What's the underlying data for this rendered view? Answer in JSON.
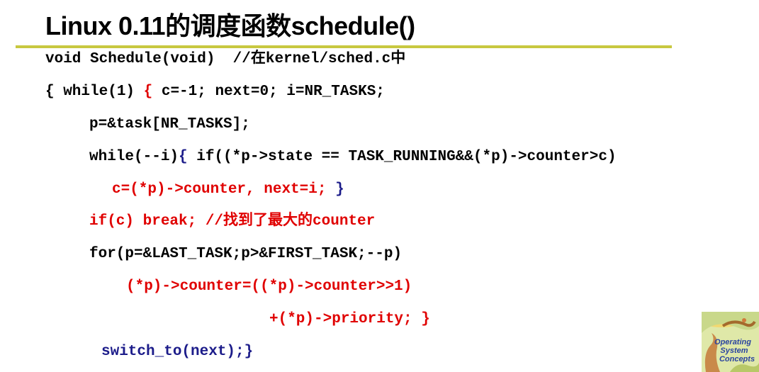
{
  "title": "Linux 0.11的调度函数schedule()",
  "colors": {
    "rule": "#c8c840",
    "code_black": "#000000",
    "code_red": "#e00000",
    "code_navy": "#1c1c8a"
  },
  "code": {
    "line1": "void Schedule(void)  //在kernel/sched.c中",
    "line2a": "{ while(1) ",
    "line2b": "{ ",
    "line2c": "c=-1; next=0; i=NR_TASKS;",
    "line3": "p=&task[NR_TASKS];",
    "line4a": "while(--i)",
    "line4b": "{ ",
    "line4c": "if((*p->state == TASK_RUNNING&&(*p)->counter>c)",
    "line5a": "c=(*p)->counter, next=i; ",
    "line5b": "}",
    "line6": "if(c) break; //找到了最大的counter",
    "line7": "for(p=&LAST_TASK;p>&FIRST_TASK;--p)",
    "line8": "(*p)->counter=((*p)->counter>>1)",
    "line9": "+(*p)->priority; }",
    "line10": "switch_to(next);}"
  },
  "cover": {
    "text_top": "Operating",
    "text_mid": "System",
    "text_bot": "Concepts",
    "icon": "dinosaur-book-cover"
  }
}
